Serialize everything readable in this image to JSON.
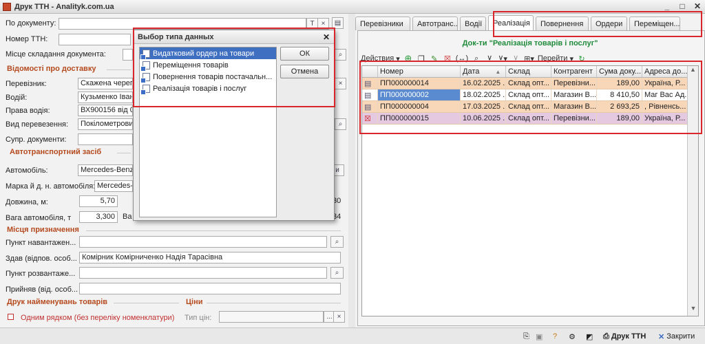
{
  "window": {
    "title": "Друк ТТН - Analityk.com.ua",
    "min": "_",
    "max": "□",
    "close": "✕"
  },
  "left": {
    "po_dokumentu_label": "По документу:",
    "nomer_ttn_label": "Номер ТТН:",
    "misce_label": "Місце складання документа:",
    "vidomosti_section": "Відомості про доставку",
    "perevoznik_label": "Перевізник:",
    "perevoznik_value": "Скажена череп",
    "vodiy_label": "Водій:",
    "vodiy_value": "Кузьменко Іван",
    "prava_label": "Права водія:",
    "prava_value": "ВХ900156 від 01.",
    "vid_perevez_label": "Вид перевезення:",
    "vid_perevez_value": "Покілометрови",
    "supr_label": "Супр. документи:",
    "avto_section": "Автотранспортний засіб",
    "avtomobil_label": "Автомобіль:",
    "avtomobil_value": "Mercedes-Benz A",
    "marka_label": "Марка й д. н. автомобіля:",
    "marka_value": "Mercedes-E",
    "dovzhyna_label": "Довжина, м:",
    "dovzhyna_value": "5,70",
    "vaga_label": "Вага автомобіля, т",
    "vaga_value": "3,300",
    "vaga_extra": "Ва",
    "right_val1": "30",
    "right_val2": "34",
    "right_btn": "и",
    "mistsia_section": "Місця призначення",
    "punkt_navant_label": "Пункт навантажен...",
    "zdav_label": "Здав (відпов. особ...",
    "zdav_value": "Комірник Комірниченко Надія Тарасівна",
    "punkt_rozvant_label": "Пункт розвантаже...",
    "pryiniav_label": "Прийняв (від. особ...",
    "druk_section": "Друк найменувань товарів",
    "tsiny_section": "Ціни",
    "odnym_label": "Одним рядком (без переліку номенклатури)",
    "typ_tsin_label": "Тип цін:",
    "ellipsis": "...",
    "x": "×",
    "t": "T"
  },
  "tabs": [
    "Перевізники",
    "Автотранс...",
    "Водії",
    "Реалізація",
    "Повернення",
    "Ордери",
    "Переміщен..."
  ],
  "right": {
    "doc_title": "Док-ти \"Реалізація товарів і послуг\"",
    "actions_label": "Действия",
    "goto_label": "Перейти",
    "columns": [
      "Номер",
      "Дата",
      "Склад",
      "Контрагент",
      "Сума доку...",
      "Адреса до..."
    ],
    "rows": [
      {
        "num": "ПП000000014",
        "date": "16.02.2025 ...",
        "sklad": "Склад опт...",
        "kontr": "Перевізни...",
        "suma": "189,00",
        "adr": "Україна, Р...",
        "bg": "#f8d7b8"
      },
      {
        "num": "ПП000000002",
        "date": "18.02.2025 ...",
        "sklad": "Склад опт...",
        "kontr": "Магазин В...",
        "suma": "8 410,50",
        "adr": "Маг Вас Ад...",
        "bg": "#ffffff"
      },
      {
        "num": "ПП000000004",
        "date": "17.03.2025 ...",
        "sklad": "Склад опт...",
        "kontr": "Магазин В...",
        "suma": "2 693,25",
        "adr": ", Рівненсь...",
        "bg": "#f8d7b8"
      },
      {
        "num": "ПП000000015",
        "date": "10.06.2025 ...",
        "sklad": "Склад опт...",
        "kontr": "Перевізни...",
        "suma": "189,00",
        "adr": "Україна, Р...",
        "bg": "#e4c9e0"
      }
    ]
  },
  "dialog": {
    "title": "Выбор типа данных",
    "items": [
      "Видатковий ордер на товари",
      "Переміщення товарів",
      "Повернення товарів постачальн...",
      "Реалізація товарів і послуг"
    ],
    "ok": "ОК",
    "cancel": "Отмена"
  },
  "bottom": {
    "print_label": "Друк ТТН",
    "close_label": "Закрити"
  },
  "colors": {
    "accent": "#b54a1e",
    "highlight": "#d8262a",
    "selected": "#3f6fc0",
    "doc_title": "#1e8a3a"
  }
}
